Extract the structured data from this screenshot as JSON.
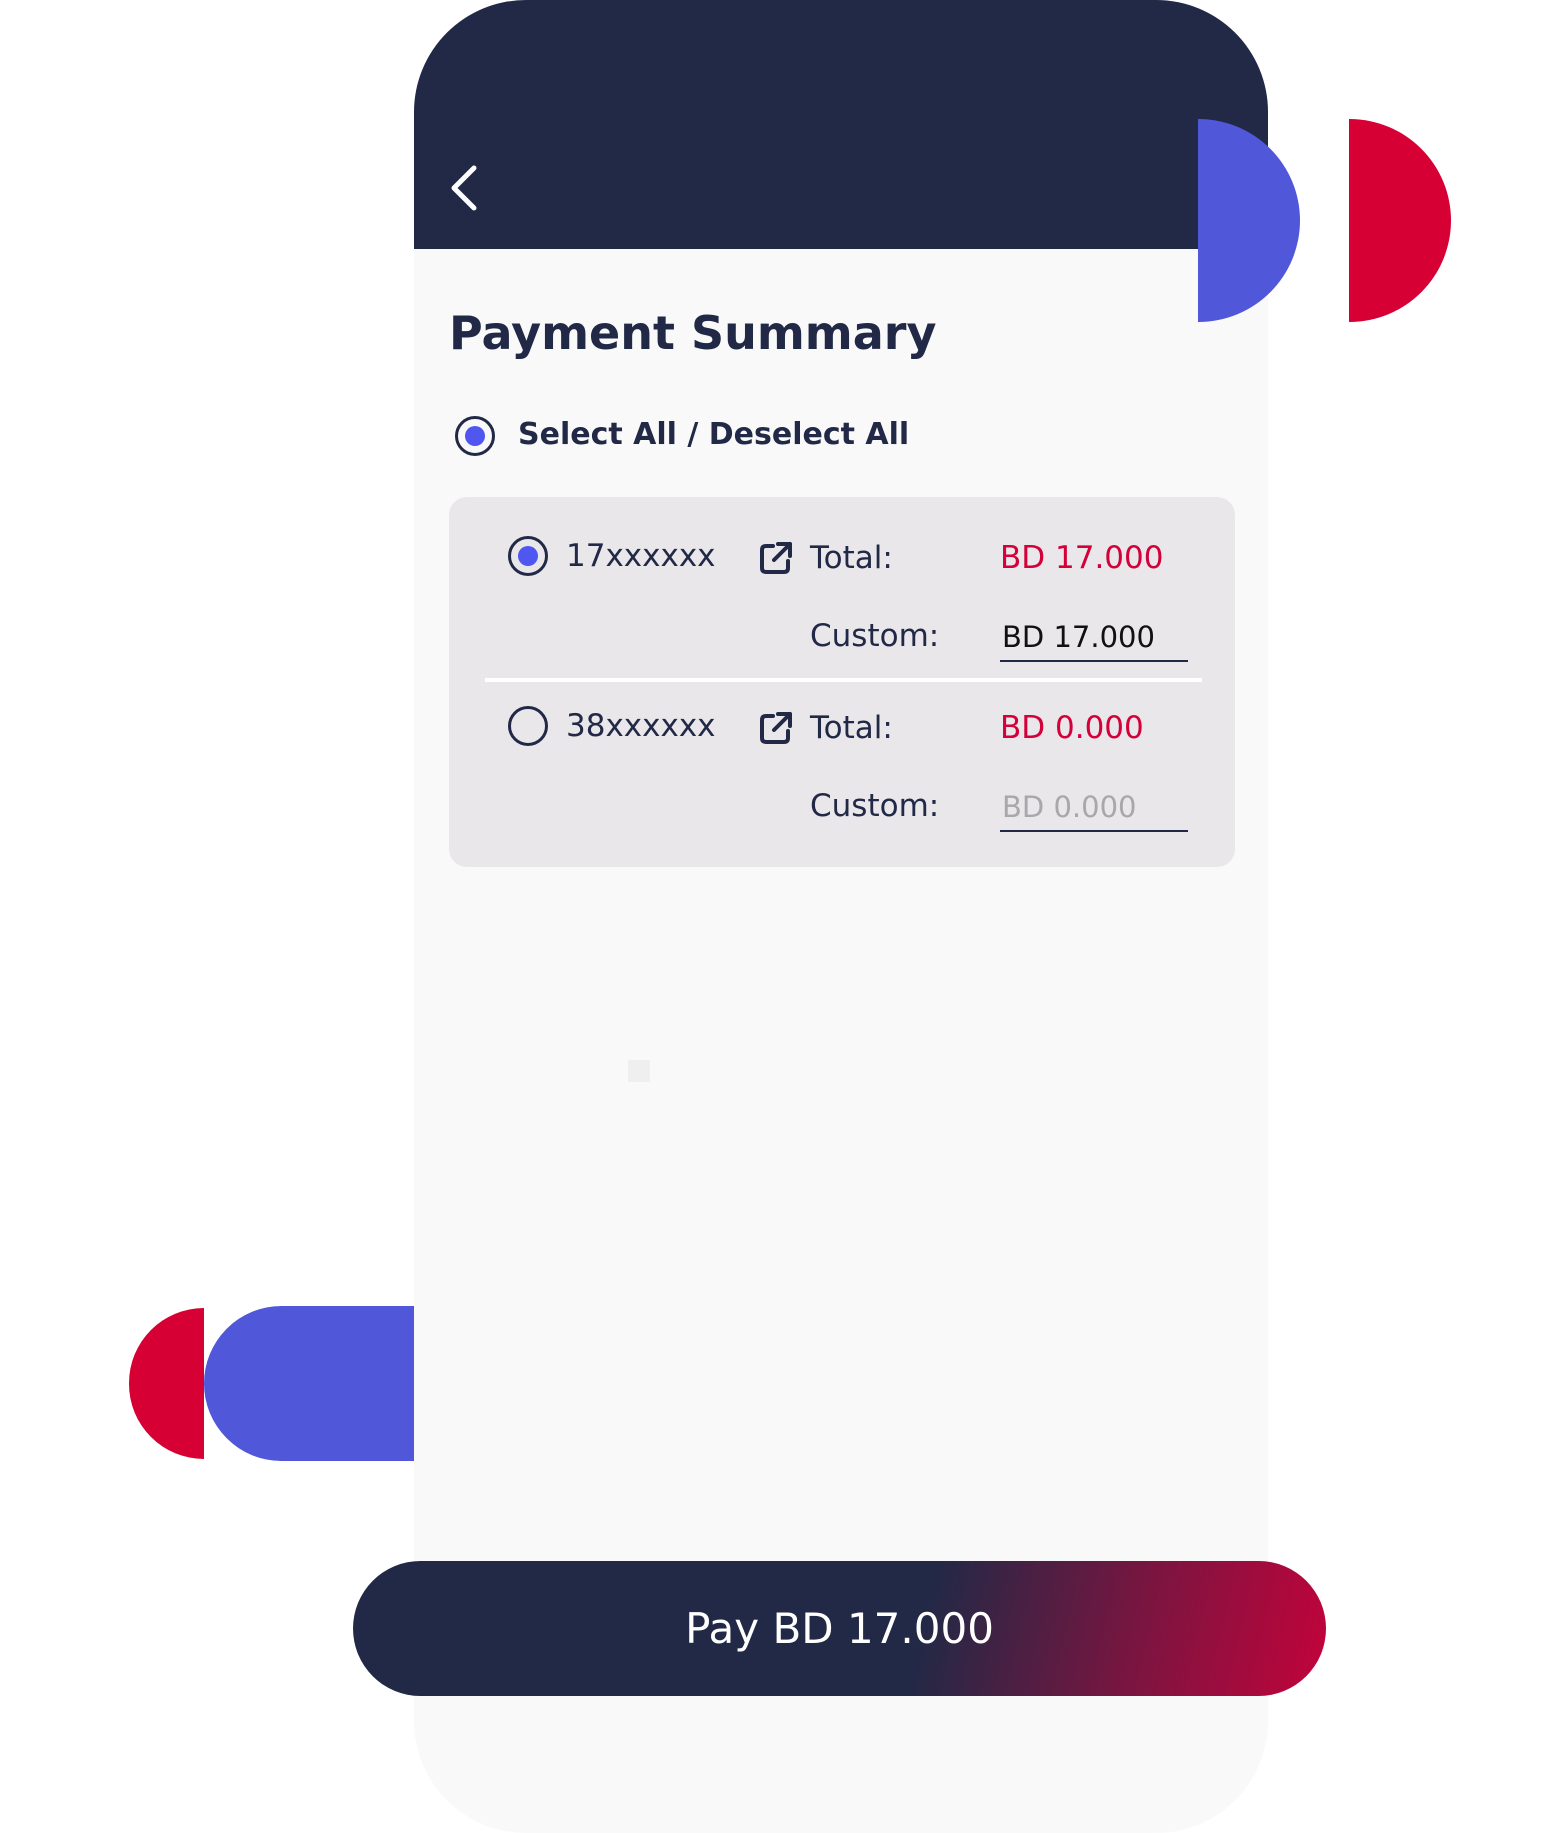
{
  "page": {
    "title": "Payment Summary"
  },
  "select_all": {
    "label": "Select All / Deselect All",
    "checked": true
  },
  "accounts": [
    {
      "number": "17xxxxxx",
      "selected": true,
      "total_label": "Total:",
      "total_value": "BD 17.000",
      "custom_label": "Custom:",
      "custom_value": "BD 17.000",
      "custom_placeholder": ""
    },
    {
      "number": "38xxxxxx",
      "selected": false,
      "total_label": "Total:",
      "total_value": "BD 0.000",
      "custom_label": "Custom:",
      "custom_value": "",
      "custom_placeholder": "BD 0.000"
    }
  ],
  "pay_button": {
    "label": "Pay BD 17.000"
  },
  "icons": {
    "back": "chevron-left-icon",
    "edit": "external-link-icon",
    "radio": "radio-button-icon"
  },
  "colors": {
    "navy": "#212946",
    "accent_blue": "#4f57f0",
    "red": "#d3003a",
    "card_bg": "#e9e7ea",
    "screen_bg": "#f9f9f9"
  }
}
